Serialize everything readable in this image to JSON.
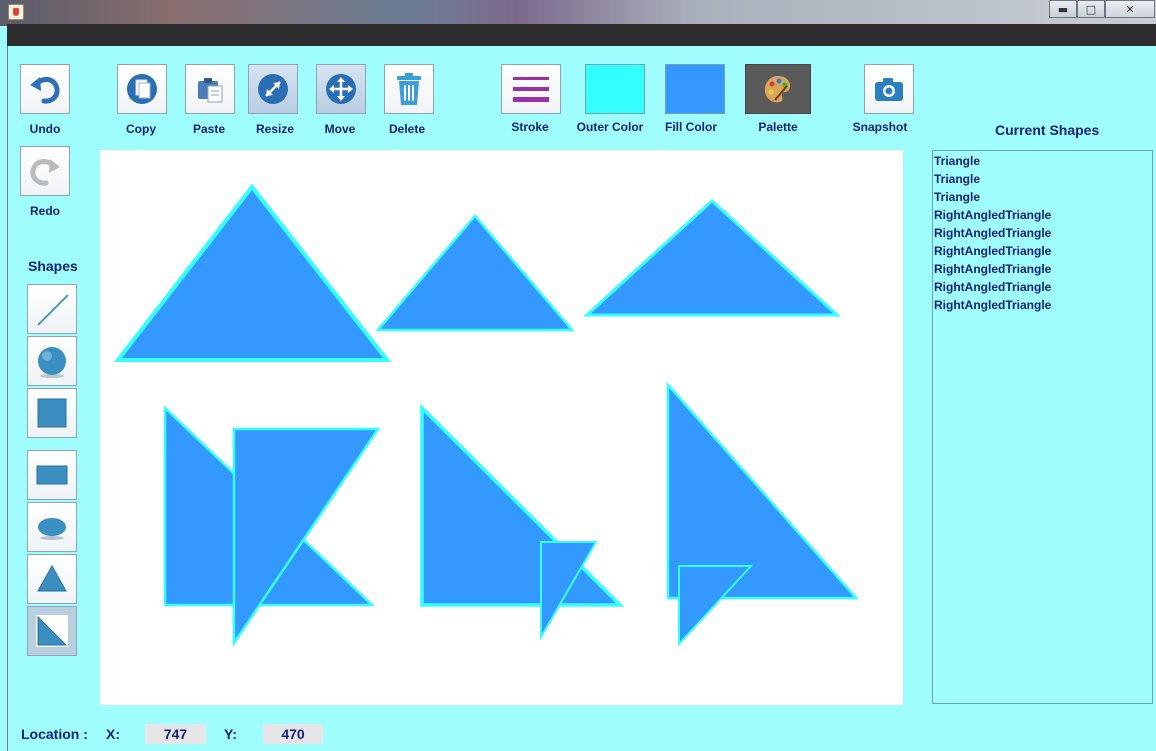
{
  "toolbar": {
    "undo_label": "Undo",
    "redo_label": "Redo",
    "copy_label": "Copy",
    "paste_label": "Paste",
    "resize_label": "Resize",
    "move_label": "Move",
    "delete_label": "Delete",
    "stroke_label": "Stroke",
    "outer_color_label": "Outer Color",
    "fill_color_label": "Fill Color",
    "palette_label": "Palette",
    "snapshot_label": "Snapshot"
  },
  "colors": {
    "outer_color": "#33ffff",
    "fill_color": "#3399ff",
    "stroke_icon": "#9b2fa8"
  },
  "shapes_panel": {
    "title": "Shapes",
    "tools": [
      "line-icon",
      "sphere-icon",
      "square-icon",
      "rectangle-icon",
      "ellipse-icon",
      "triangle-icon",
      "right-triangle-icon"
    ],
    "selected_tool": "right-triangle-icon"
  },
  "current_shapes": {
    "title": "Current Shapes",
    "items": [
      "Triangle",
      "Triangle",
      "Triangle",
      "RightAngledTriangle",
      "RightAngledTriangle",
      "RightAngledTriangle",
      "RightAngledTriangle",
      "RightAngledTriangle",
      "RightAngledTriangle"
    ]
  },
  "status": {
    "location_label": "Location :",
    "x_label": "X:",
    "x_value": "747",
    "y_label": "Y:",
    "y_value": "470"
  }
}
